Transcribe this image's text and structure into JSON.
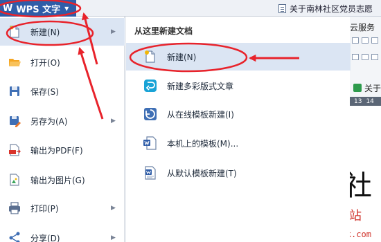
{
  "app_button": {
    "logo": "W",
    "label": "WPS 文字",
    "arrow": "▼"
  },
  "doc_tab": {
    "title": "关于南林社区党员志愿"
  },
  "background": {
    "cloud_service": "云服务",
    "pill_label": "关于",
    "ruler_numbers": [
      "13",
      "14"
    ],
    "document_char": "社"
  },
  "watermark": {
    "cn": "易采站长站",
    "url": "www.easck.com"
  },
  "left_menu": {
    "items": [
      {
        "label": "新建(N)",
        "icon": "new-file-icon",
        "has_submenu": true,
        "active": true
      },
      {
        "label": "打开(O)",
        "icon": "folder-open-icon",
        "has_submenu": false
      },
      {
        "label": "保存(S)",
        "icon": "save-icon",
        "has_submenu": false
      },
      {
        "label": "另存为(A)",
        "icon": "save-as-icon",
        "has_submenu": true
      },
      {
        "label": "输出为PDF(F)",
        "icon": "pdf-icon",
        "has_submenu": false
      },
      {
        "label": "输出为图片(G)",
        "icon": "image-export-icon",
        "has_submenu": false
      },
      {
        "label": "打印(P)",
        "icon": "print-icon",
        "has_submenu": true
      },
      {
        "label": "分享(D)",
        "icon": "share-icon",
        "has_submenu": true
      }
    ]
  },
  "sub_menu": {
    "title": "从这里新建文档",
    "items": [
      {
        "label": "新建(N)",
        "icon": "new-document-icon",
        "active": true
      },
      {
        "label": "新建多彩版式文章",
        "icon": "colorful-article-icon"
      },
      {
        "label": "从在线模板新建(I)",
        "icon": "online-template-icon"
      },
      {
        "label": "本机上的模板(M)...",
        "icon": "local-template-icon"
      },
      {
        "label": "从默认模板新建(T)",
        "icon": "default-template-icon"
      }
    ]
  },
  "colors": {
    "accent": "#2f5da8",
    "highlight": "#dbe5f3",
    "annotation_red": "#e8232b",
    "watermark_red": "#d0342c"
  }
}
